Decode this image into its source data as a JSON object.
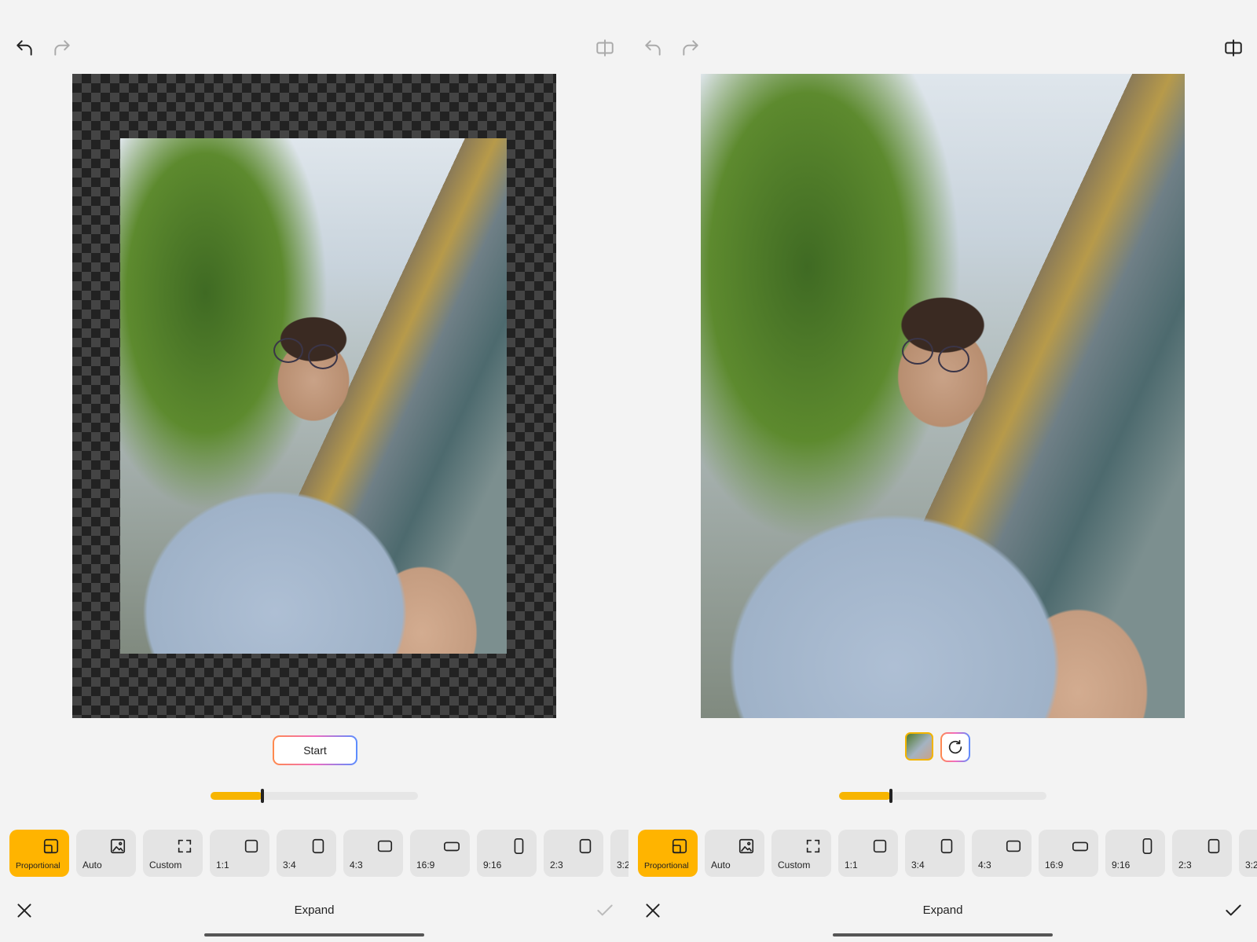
{
  "left_pane": {
    "start_label": "Start",
    "slider_value_pct": 25,
    "bottom_title": "Expand",
    "confirm_enabled": false
  },
  "right_pane": {
    "slider_value_pct": 25,
    "bottom_title": "Expand",
    "confirm_enabled": true
  },
  "ratio_options": [
    {
      "label": "Proportional",
      "icon": "proportional-icon",
      "selected": true
    },
    {
      "label": "Auto",
      "icon": "image-icon",
      "selected": false
    },
    {
      "label": "Custom",
      "icon": "custom-frame-icon",
      "selected": false
    },
    {
      "label": "1:1",
      "icon": "square-icon",
      "selected": false
    },
    {
      "label": "3:4",
      "icon": "portrait-rect-icon",
      "selected": false
    },
    {
      "label": "4:3",
      "icon": "landscape-rect-icon",
      "selected": false
    },
    {
      "label": "16:9",
      "icon": "wide-rect-icon",
      "selected": false
    },
    {
      "label": "9:16",
      "icon": "tall-rect-icon",
      "selected": false
    },
    {
      "label": "2:3",
      "icon": "portrait-rect-icon",
      "selected": false
    },
    {
      "label": "3:2",
      "icon": "landscape-rect-icon",
      "selected": false
    }
  ],
  "colors": {
    "accent": "#ffb400",
    "slider_fill": "#f7b500",
    "background": "#f3f3f3",
    "chip": "#e4e4e4"
  }
}
